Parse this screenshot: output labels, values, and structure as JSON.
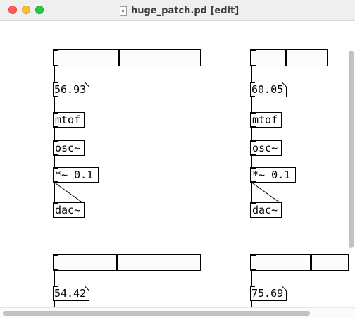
{
  "window": {
    "title": "huge_patch.pd [edit]"
  },
  "patch": {
    "col1": {
      "number": "56.93",
      "mtof": "mtof",
      "osc": "osc~",
      "mul": "*~ 0.1",
      "dac": "dac~",
      "slider_value": 0.45
    },
    "col2": {
      "number": "60.05",
      "mtof": "mtof",
      "osc": "osc~",
      "mul": "*~ 0.1",
      "dac": "dac~",
      "slider_value": 0.47
    },
    "col3": {
      "number": "54.42",
      "slider_value": 0.43
    },
    "col4": {
      "number": "75.69",
      "slider_value": 0.62
    }
  }
}
